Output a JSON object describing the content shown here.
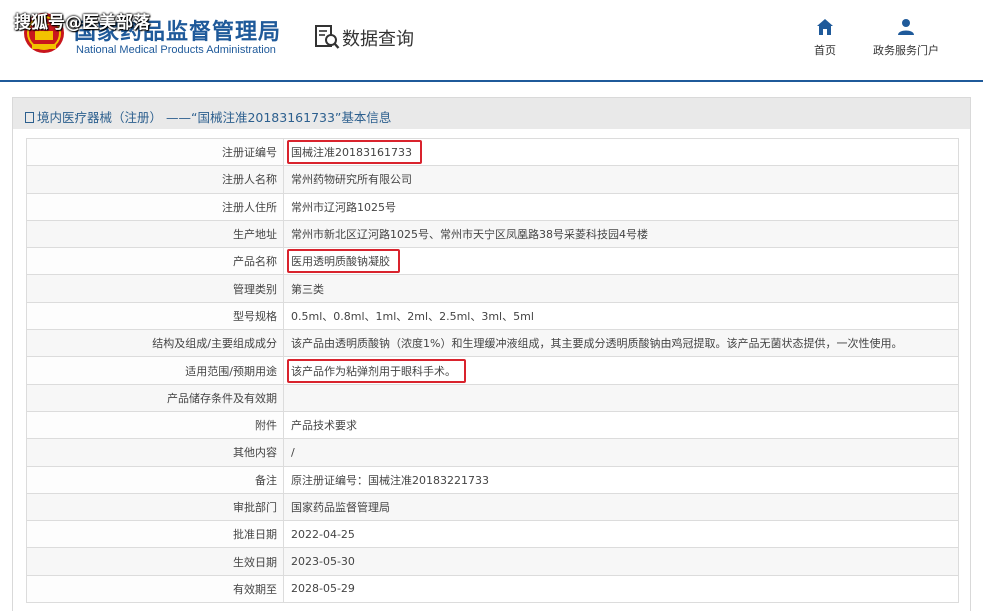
{
  "header": {
    "watermark": "搜狐号@医美部落",
    "logo_cn": "国家药品监督管理局",
    "logo_en": "National Medical Products Administration",
    "page_title": "数据查询",
    "nav": [
      {
        "label": "首页",
        "icon": "home-icon"
      },
      {
        "label": "政务服务门户",
        "icon": "user-icon"
      }
    ]
  },
  "panel": {
    "title": "境内医疗器械（注册） ——“国械注准20183161733”基本信息"
  },
  "rows": [
    {
      "label": "注册证编号",
      "value": "国械注准20183161733",
      "highlight": true
    },
    {
      "label": "注册人名称",
      "value": "常州药物研究所有限公司"
    },
    {
      "label": "注册人住所",
      "value": "常州市辽河路1025号"
    },
    {
      "label": "生产地址",
      "value": "常州市新北区辽河路1025号、常州市天宁区凤凰路38号采菱科技园4号楼"
    },
    {
      "label": "产品名称",
      "value": "医用透明质酸钠凝胶",
      "highlight": true
    },
    {
      "label": "管理类别",
      "value": "第三类"
    },
    {
      "label": "型号规格",
      "value": "0.5ml、0.8ml、1ml、2ml、2.5ml、3ml、5ml"
    },
    {
      "label": "结构及组成/主要组成成分",
      "value": "该产品由透明质酸钠（浓度1%）和生理缓冲液组成，其主要成分透明质酸钠由鸡冠提取。该产品无菌状态提供，一次性使用。"
    },
    {
      "label": "适用范围/预期用途",
      "value": "该产品作为粘弹剂用于眼科手术。",
      "highlight": true
    },
    {
      "label": "产品储存条件及有效期",
      "value": ""
    },
    {
      "label": "附件",
      "value": "产品技术要求"
    },
    {
      "label": "其他内容",
      "value": "/"
    },
    {
      "label": "备注",
      "value": "原注册证编号：国械注准20183221733"
    },
    {
      "label": "审批部门",
      "value": "国家药品监督管理局"
    },
    {
      "label": "批准日期",
      "value": "2022-04-25"
    },
    {
      "label": "生效日期",
      "value": "2023-05-30"
    },
    {
      "label": "有效期至",
      "value": "2028-05-29"
    }
  ]
}
